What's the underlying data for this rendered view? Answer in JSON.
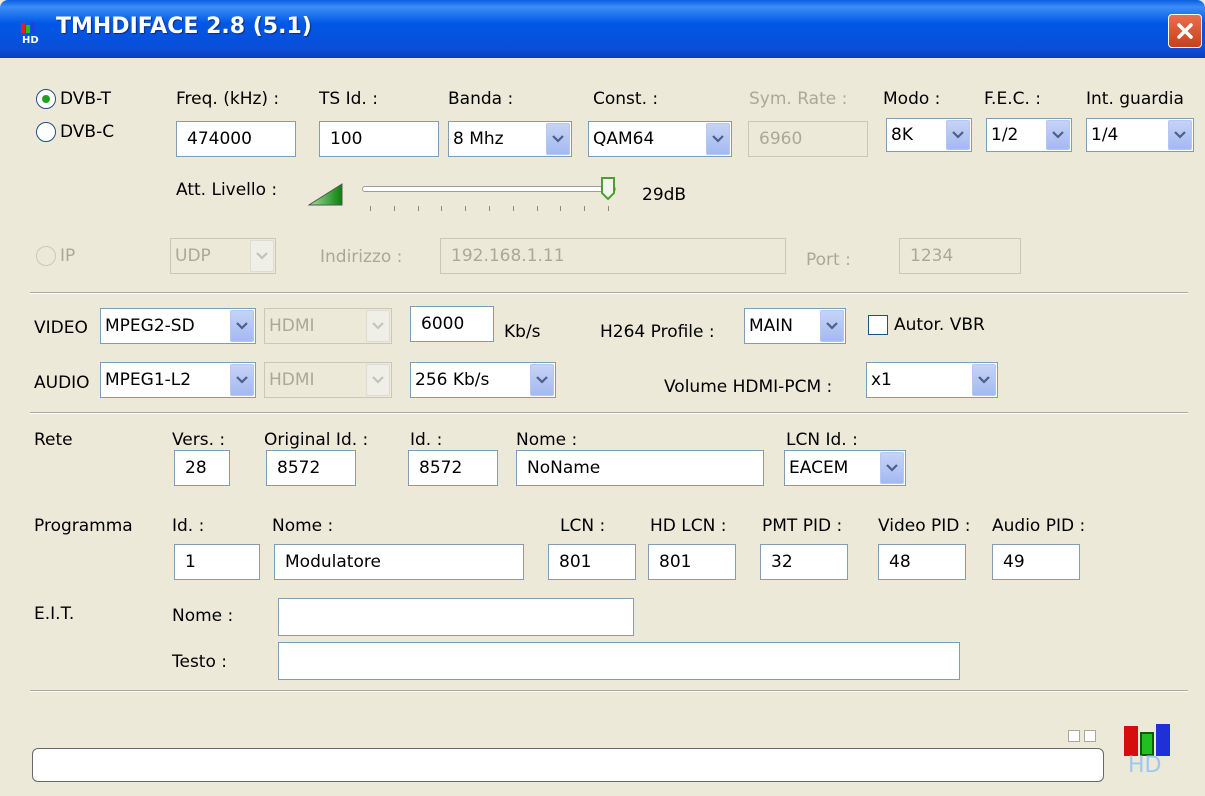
{
  "window": {
    "title": "TMHDIFACE 2.8 (5.1)"
  },
  "icons": {
    "app": "app-icon",
    "close": "close-icon",
    "level": "level-ramp-icon",
    "hd_logo": "hd-bars-logo",
    "dropdown": "chevron-down-icon"
  },
  "colors": {
    "title_bar": "#0058e6",
    "close": "#d64a26",
    "radio_dot": "#21a121",
    "body": "#ece9d8"
  },
  "tuner": {
    "dvbt_label": "DVB-T",
    "dvbc_label": "DVB-C",
    "selected": "DVB-T",
    "freq_label": "Freq. (kHz) :",
    "freq_value": "474000",
    "tsid_label": "TS Id. :",
    "tsid_value": "100",
    "banda_label": "Banda :",
    "banda_value": "8 Mhz",
    "const_label": "Const. :",
    "const_value": "QAM64",
    "symrate_label": "Sym. Rate :",
    "symrate_value": "6960",
    "modo_label": "Modo :",
    "modo_value": "8K",
    "fec_label": "F.E.C. :",
    "fec_value": "1/2",
    "guard_label": "Int. guardia",
    "guard_value": "1/4",
    "att_label": "Att. Livello :",
    "att_value": "29dB",
    "att_fraction": 1.0
  },
  "ip": {
    "label": "IP",
    "proto_value": "UDP",
    "addr_label": "Indirizzo :",
    "addr_value": "192.168.1.11",
    "port_label": "Port :",
    "port_value": "1234"
  },
  "av": {
    "video_label": "VIDEO",
    "video_codec": "MPEG2-SD",
    "video_input": "HDMI",
    "video_rate": "6000",
    "kbs_label": "Kb/s",
    "h264_label": "H264 Profile :",
    "h264_value": "MAIN",
    "vbr_label": "Autor. VBR",
    "audio_label": "AUDIO",
    "audio_codec": "MPEG1-L2",
    "audio_input": "HDMI",
    "audio_rate": "256 Kb/s",
    "volume_label": "Volume HDMI-PCM :",
    "volume_value": "x1"
  },
  "rete": {
    "label": "Rete",
    "vers_label": "Vers. :",
    "vers_value": "28",
    "orig_label": "Original Id. :",
    "orig_value": "8572",
    "id_label": "Id. :",
    "id_value": "8572",
    "nome_label": "Nome :",
    "nome_value": "NoName",
    "lcnid_label": "LCN Id. :",
    "lcnid_value": "EACEM"
  },
  "programma": {
    "label": "Programma",
    "id_label": "Id. :",
    "id_value": "1",
    "nome_label": "Nome :",
    "nome_value": "Modulatore",
    "lcn_label": "LCN :",
    "lcn_value": "801",
    "hdlcn_label": "HD LCN :",
    "hdlcn_value": "801",
    "pmt_label": "PMT PID :",
    "pmt_value": "32",
    "vpid_label": "Video PID :",
    "vpid_value": "48",
    "apid_label": "Audio PID :",
    "apid_value": "49"
  },
  "eit": {
    "label": "E.I.T.",
    "nome_label": "Nome :",
    "nome_value": "",
    "testo_label": "Testo :",
    "testo_value": ""
  },
  "status": {
    "logo_text": "HD",
    "progress_fraction": 0
  }
}
